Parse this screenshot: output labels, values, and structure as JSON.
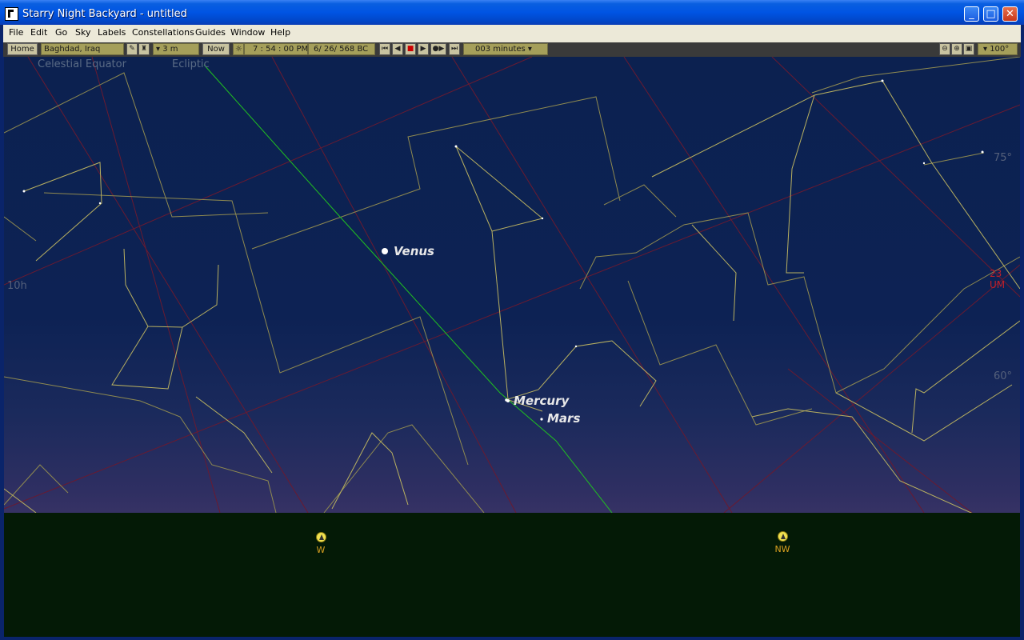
{
  "window": {
    "title": "Starry Night Backyard - untitled",
    "minimize": "_",
    "maximize": "□",
    "close": "✕"
  },
  "menu": [
    "File",
    "Edit",
    "Go",
    "Sky",
    "Labels",
    "Constellations",
    "Guides",
    "Window",
    "Help"
  ],
  "toolbar": {
    "home": "Home",
    "location": "Baghdad, Iraq",
    "elevation": "▾ 3 m",
    "now": "Now",
    "time": "7 : 54 : 00 PM",
    "date": "6/ 26/   568 BC",
    "timestep": "003 minutes ▾",
    "fov": "▾ 100°"
  },
  "sky_labels": {
    "celestial_equator": "Celestial Equator",
    "ecliptic": "Ecliptic",
    "ra_10h": "10h",
    "alt_75": "75°",
    "alt_60": "60°",
    "red_marker": "23 UM"
  },
  "planets": [
    {
      "name": "Venus"
    },
    {
      "name": "Mercury"
    },
    {
      "name": "Mars"
    }
  ],
  "compass": [
    {
      "label": "W"
    },
    {
      "label": "NW"
    }
  ],
  "colors": {
    "sky": "#0c2150",
    "ground": "#041a06",
    "constellation_lines": "#b8b060",
    "ecliptic": "#20c020",
    "grid": "#6a1a30",
    "compass_label": "#d9a020"
  }
}
